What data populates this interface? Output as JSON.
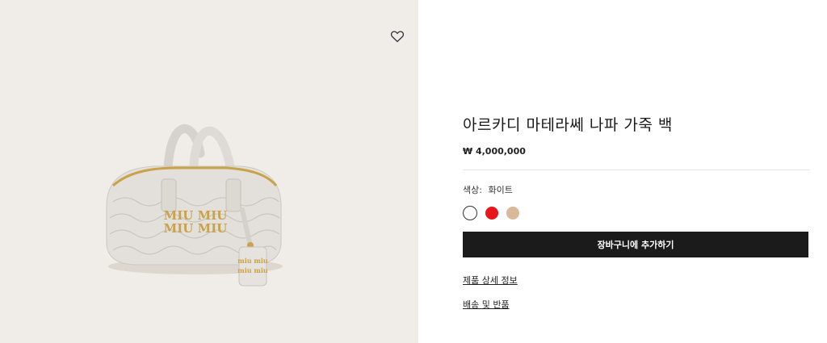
{
  "product": {
    "title": "아르카디 마테라쎄 나파 가죽 백",
    "price": "₩ 4,000,000",
    "color_label": "색상:",
    "color_value": "화이트",
    "swatches": [
      {
        "name": "white",
        "color": "#ffffff"
      },
      {
        "name": "red",
        "color": "#e8151b"
      },
      {
        "name": "beige",
        "color": "#d8b99a"
      }
    ],
    "add_to_cart": "장바구니에 추가하기",
    "details_link": "제품 상세 정보",
    "shipping_link": "배송 및 반품"
  },
  "image": {
    "background": "#f0ece7",
    "logo_text": "miu miu",
    "wishlist_icon": "heart-outline-icon"
  }
}
